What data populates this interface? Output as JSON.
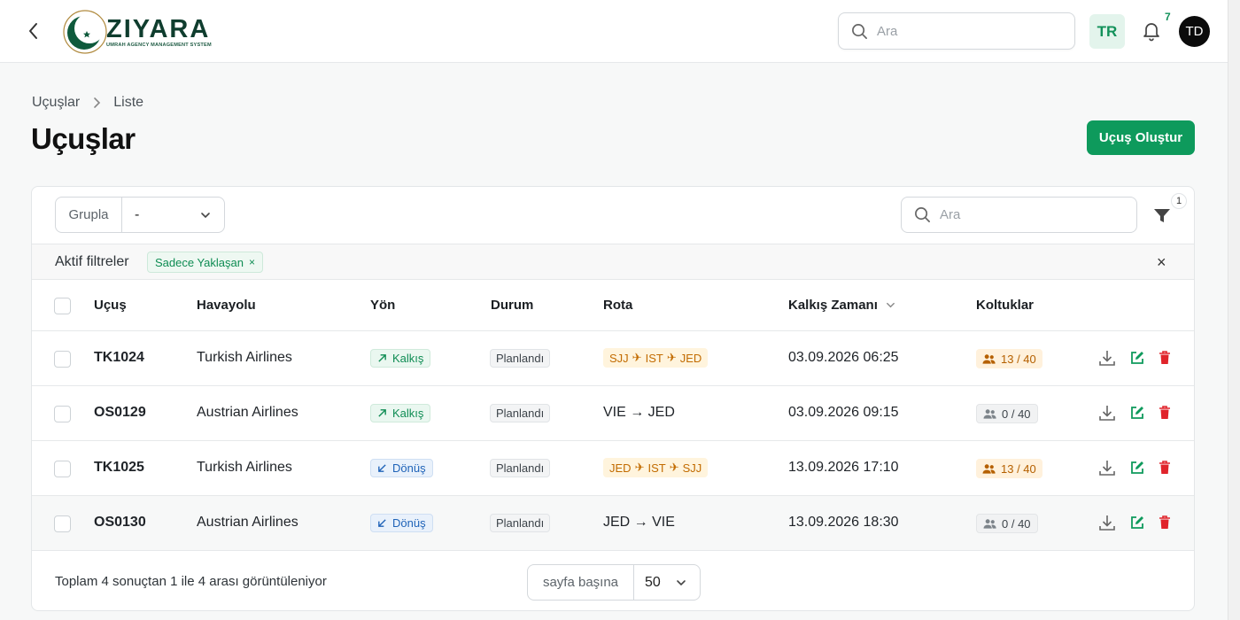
{
  "header": {
    "logo_name": "ZIYARA",
    "logo_tagline": "UMRAH AGENCY MANAGEMENT SYSTEM",
    "search_placeholder": "Ara",
    "language": "TR",
    "notification_count": "7",
    "avatar_initials": "TD"
  },
  "breadcrumb": {
    "items": [
      "Uçuşlar",
      "Liste"
    ]
  },
  "page": {
    "title": "Uçuşlar",
    "create_button": "Uçuş Oluştur"
  },
  "toolbar": {
    "group_label": "Grupla",
    "group_value": "-",
    "search_placeholder": "Ara",
    "filter_count": "1"
  },
  "active_filters": {
    "label": "Aktif filtreler",
    "chips": [
      "Sadece Yaklaşan"
    ]
  },
  "table": {
    "columns": [
      "Uçuş",
      "Havayolu",
      "Yön",
      "Durum",
      "Rota",
      "Kalkış Zamanı",
      "Koltuklar"
    ],
    "rows": [
      {
        "flight": "TK1024",
        "airline": "Turkish Airlines",
        "direction": "Kalkış",
        "status": "Planlandı",
        "route": [
          "SJJ",
          "IST",
          "JED"
        ],
        "departure": "03.09.2026 06:25",
        "seats": "13 / 40"
      },
      {
        "flight": "OS0129",
        "airline": "Austrian Airlines",
        "direction": "Kalkış",
        "status": "Planlandı",
        "route_text": "VIE → JED",
        "departure": "03.09.2026 09:15",
        "seats": "0 / 40"
      },
      {
        "flight": "TK1025",
        "airline": "Turkish Airlines",
        "direction": "Dönüş",
        "status": "Planlandı",
        "route": [
          "JED",
          "IST",
          "SJJ"
        ],
        "departure": "13.09.2026 17:10",
        "seats": "13 / 40"
      },
      {
        "flight": "OS0130",
        "airline": "Austrian Airlines",
        "direction": "Dönüş",
        "status": "Planlandı",
        "route_text": "JED → VIE",
        "departure": "13.09.2026 18:30",
        "seats": "0 / 40"
      }
    ]
  },
  "footer": {
    "summary": "Toplam 4 sonuçtan 1 ile 4 arası görüntüleniyor",
    "per_page_label": "sayfa başına",
    "per_page_value": "50"
  },
  "colors": {
    "accent": "#0e9a5c",
    "delete": "#e0242b"
  }
}
